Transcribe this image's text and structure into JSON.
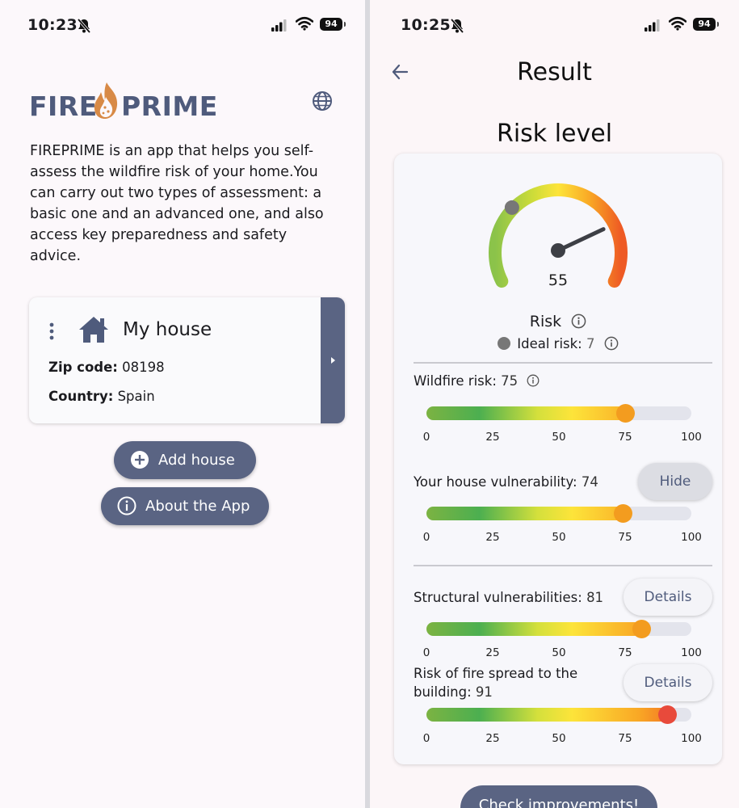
{
  "left": {
    "status": {
      "time": "10:23",
      "battery": "94"
    },
    "logo": {
      "part1": "FIRE",
      "part2": "PRIME"
    },
    "intro": "FIREPRIME is an app that helps you self-assess the wildfire risk of your home.You can carry out two types of assessment: a basic one and an advanced one, and also access key preparedness and safety advice.",
    "house": {
      "name": "My house",
      "zip_label": "Zip code:",
      "zip_value": "08198",
      "country_label": "Country:",
      "country_value": "Spain"
    },
    "buttons": {
      "add_house": "Add house",
      "about": "About the App"
    }
  },
  "right": {
    "status": {
      "time": "10:25",
      "battery": "94"
    },
    "title": "Result",
    "section_title": "Risk level",
    "gauge": {
      "value": 55,
      "ideal": 7,
      "min": 0,
      "max": 100
    },
    "risk_label": "Risk",
    "ideal_label": "Ideal risk:",
    "ideal_value": "7",
    "ticks": [
      "0",
      "25",
      "50",
      "75",
      "100"
    ],
    "metrics": [
      {
        "label": "Wildfire risk:",
        "value": 75,
        "value_text": "75",
        "knob_color": "#f39c1f"
      },
      {
        "label": "Your house vulnerability:",
        "value": 74,
        "value_text": "74",
        "knob_color": "#f39c1f",
        "button": "Hide"
      },
      {
        "label": "Structural vulnerabilities:",
        "value": 81,
        "value_text": "81",
        "knob_color": "#f39c1f",
        "button": "Details"
      },
      {
        "label_line1": "Risk of fire spread to the",
        "label_line2": "building:",
        "value": 91,
        "value_text": "91",
        "knob_color": "#e84a3b",
        "button": "Details"
      }
    ],
    "check_button": "Check improvements!"
  }
}
